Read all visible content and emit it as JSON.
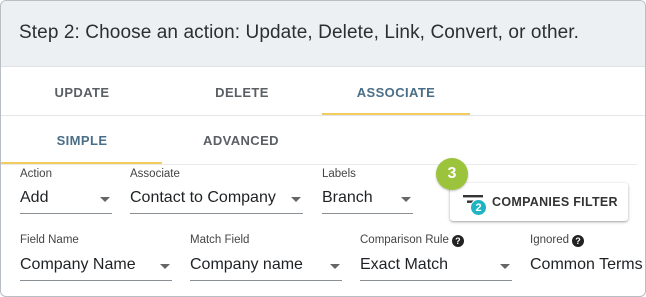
{
  "header": {
    "title": "Step 2: Choose an action: Update, Delete, Link, Convert, or other."
  },
  "main_tabs": [
    {
      "label": "UPDATE",
      "active": false
    },
    {
      "label": "DELETE",
      "active": false
    },
    {
      "label": "ASSOCIATE",
      "active": true
    }
  ],
  "sub_tabs": [
    {
      "label": "SIMPLE",
      "active": true
    },
    {
      "label": "ADVANCED",
      "active": false
    }
  ],
  "row1": {
    "action": {
      "label": "Action",
      "value": "Add"
    },
    "associate": {
      "label": "Associate",
      "value": "Contact to Company"
    },
    "labels": {
      "label": "Labels",
      "value": "Branch"
    }
  },
  "filter_button": {
    "label": "COMPANIES FILTER",
    "badge": "2",
    "icon": "filter-icon"
  },
  "step_badge": "3",
  "row2": {
    "field_name": {
      "label": "Field Name",
      "value": "Company Name"
    },
    "match_field": {
      "label": "Match Field",
      "value": "Company name"
    },
    "comparison_rule": {
      "label": "Comparison Rule",
      "value": "Exact Match",
      "help": "?"
    },
    "ignored": {
      "label": "Ignored",
      "value": "Common Terms",
      "help": "?"
    }
  },
  "colors": {
    "tab_underline": "#f2cc5d",
    "active_tab": "#4a6e87",
    "step_badge": "#9cc33c",
    "filter_badge": "#1eb4c4",
    "header_bg": "#edf0f3"
  }
}
